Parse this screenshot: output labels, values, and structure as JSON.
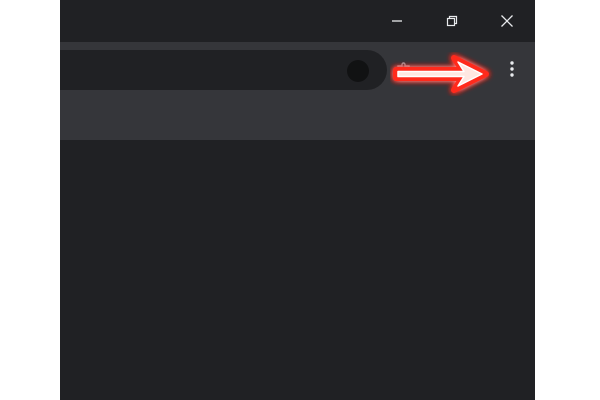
{
  "window": {
    "controls": {
      "minimize_icon": "minimize-icon",
      "restore_icon": "restore-icon",
      "close_icon": "close-icon"
    }
  },
  "toolbar": {
    "address_bar_value": "",
    "bookmark_icon": "star-icon",
    "profile_icon": "avatar",
    "extension_icon": "puzzle-icon",
    "menu_icon": "vertical-dots-icon"
  },
  "annotation": {
    "arrow_icon": "arrow-right-icon",
    "arrow_color": "#ff2a1f"
  },
  "colors": {
    "frame": "#202124",
    "toolbar": "#35363a",
    "icon": "#e8eaed",
    "content": "#202124"
  }
}
